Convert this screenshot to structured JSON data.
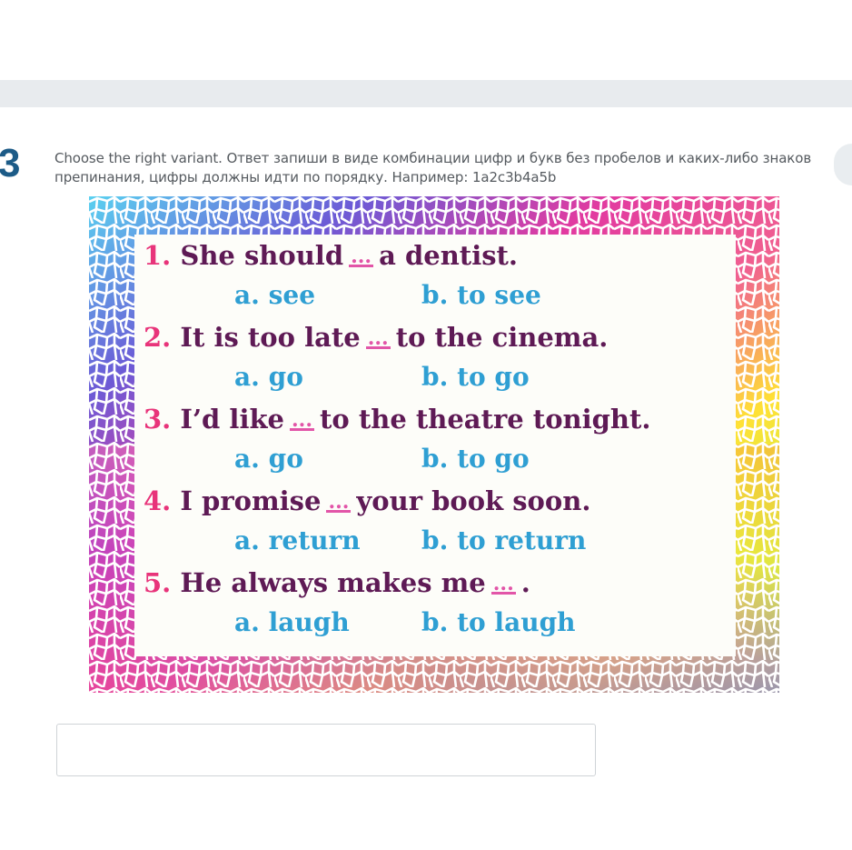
{
  "question": {
    "number": "3",
    "instruction": "Choose the right variant. Ответ запиши в виде комбинации цифр и букв без пробелов и каких-либо знаков препинания, цифры должны идти по порядку. Например: 1a2c3b4a5b"
  },
  "exercise": {
    "items": [
      {
        "num": "1.",
        "before": "She should",
        "blank": "...",
        "after": "a dentist.",
        "option_a": "a. see",
        "option_b": "b. to see"
      },
      {
        "num": "2.",
        "before": "It is too late",
        "blank": "...",
        "after": "to the cinema.",
        "option_a": "a. go",
        "option_b": "b. to go"
      },
      {
        "num": "3.",
        "before": "I’d like",
        "blank": "...",
        "after": "to the theatre tonight.",
        "option_a": "a. go",
        "option_b": "b. to go"
      },
      {
        "num": "4.",
        "before": "I promise",
        "blank": "...",
        "after": "your book soon.",
        "option_a": "a. return",
        "option_b": "b. to return"
      },
      {
        "num": "5.",
        "before": "He always makes me",
        "blank": "...",
        "after": ".",
        "option_a": "a. laugh",
        "option_b": "b. to laugh"
      }
    ]
  },
  "answer": {
    "value": "",
    "placeholder": ""
  },
  "colors": {
    "question_number": "#1c5b87",
    "sentence_text": "#5e1a55",
    "item_number": "#e8347a",
    "blank": "#e255a8",
    "option_text": "#2f9fd3",
    "top_bar": "#e8ebee"
  }
}
